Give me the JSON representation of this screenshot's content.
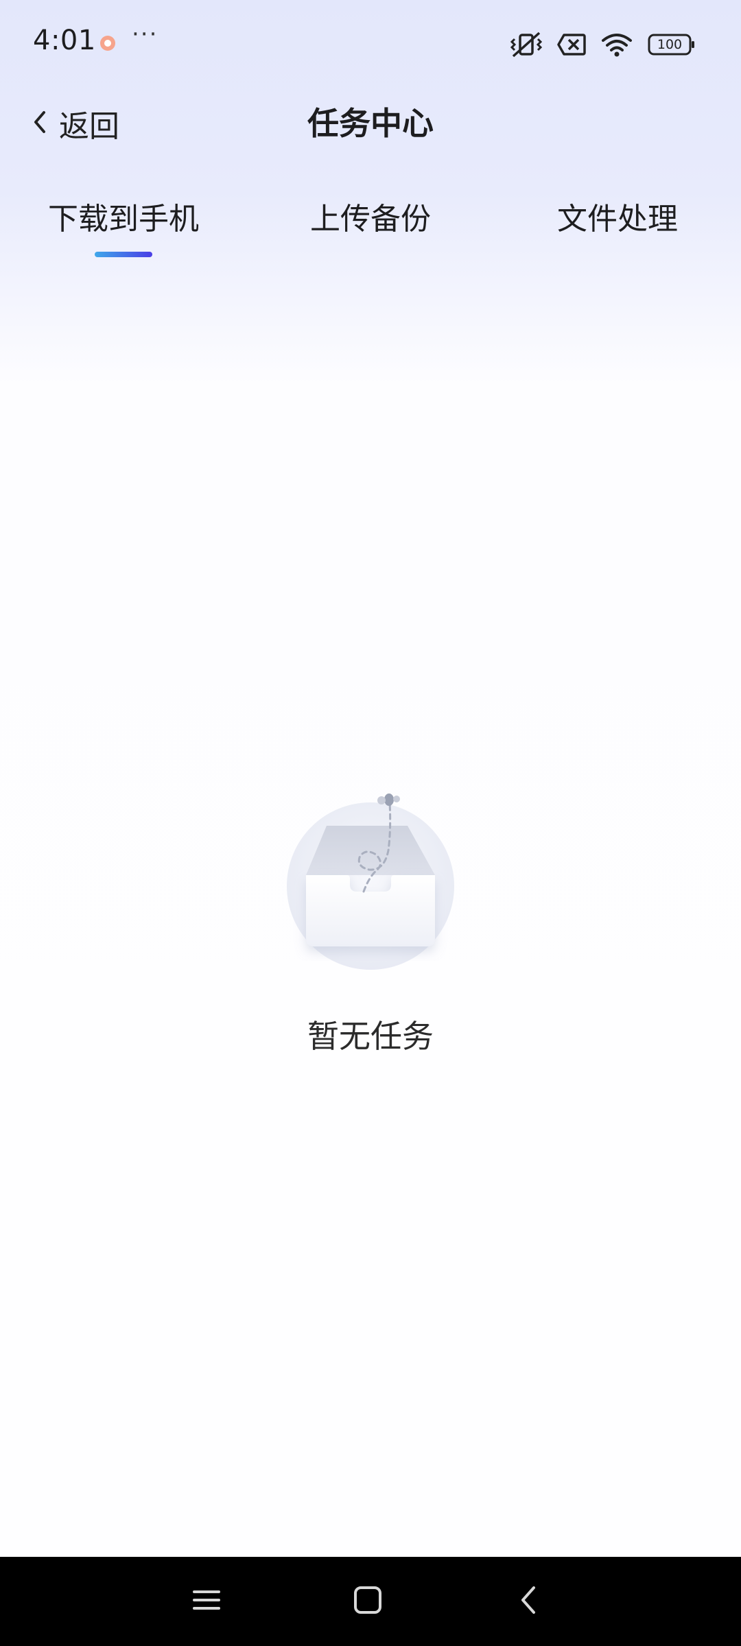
{
  "status_bar": {
    "time": "4:01",
    "more": "···",
    "battery": "100"
  },
  "header": {
    "back_label": "返回",
    "title": "任务中心"
  },
  "tabs": [
    {
      "label": "下载到手机",
      "active": true
    },
    {
      "label": "上传备份",
      "active": false
    },
    {
      "label": "文件处理",
      "active": false
    }
  ],
  "empty_state": {
    "message": "暂无任务",
    "icon": "empty-inbox-icon"
  },
  "nav_bar": {
    "items": [
      "menu-icon",
      "home-icon",
      "back-icon"
    ]
  },
  "colors": {
    "indicator_start": "#3fa7ea",
    "indicator_end": "#4a3ee6",
    "header_bg": "#e3e7fb",
    "text": "#1d1d1f"
  }
}
